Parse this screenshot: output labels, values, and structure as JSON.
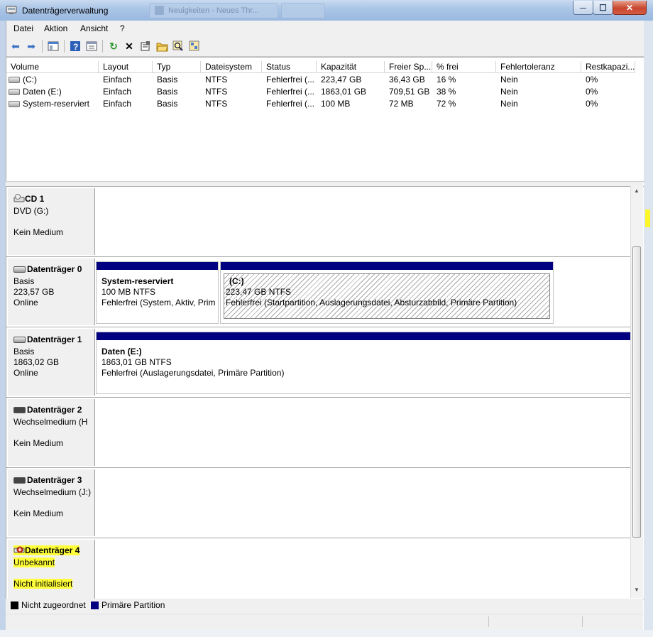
{
  "window": {
    "title": "Datenträgerverwaltung",
    "ghost_tabs": [
      "Neuigkeiten - Neues Thr..."
    ],
    "buttons": {
      "minimize": "─",
      "maximize": "☐",
      "close": "✕"
    }
  },
  "menu": [
    "Datei",
    "Aktion",
    "Ansicht",
    "?"
  ],
  "toolbar_icons": [
    "back-arrow-icon",
    "forward-arrow-icon",
    "console-tree-icon",
    "help-icon",
    "show-hide-icon",
    "refresh-icon",
    "delete-icon",
    "properties-icon",
    "open-folder-icon",
    "search-icon",
    "explore-icon"
  ],
  "volume_list": {
    "columns": [
      "Volume",
      "Layout",
      "Typ",
      "Dateisystem",
      "Status",
      "Kapazität",
      "Freier Sp...",
      "% frei",
      "Fehlertoleranz",
      "Restkapazi..."
    ],
    "rows": [
      [
        "(C:)",
        "Einfach",
        "Basis",
        "NTFS",
        "Fehlerfrei (...",
        "223,47 GB",
        "36,43 GB",
        "16 %",
        "Nein",
        "0%"
      ],
      [
        "Daten (E:)",
        "Einfach",
        "Basis",
        "NTFS",
        "Fehlerfrei (...",
        "1863,01 GB",
        "709,51 GB",
        "38 %",
        "Nein",
        "0%"
      ],
      [
        "System-reserviert",
        "Einfach",
        "Basis",
        "NTFS",
        "Fehlerfrei (...",
        "100 MB",
        "72 MB",
        "72 %",
        "Nein",
        "0%"
      ]
    ]
  },
  "disks": [
    {
      "name": "CD 1",
      "line1": "DVD (G:)",
      "line2": "",
      "line3": "Kein Medium",
      "partitions": []
    },
    {
      "name": "Datenträger 0",
      "line1": "Basis",
      "line2": "223,57 GB",
      "line3": "Online",
      "partitions": [
        {
          "title": "System-reserviert",
          "size": "100 MB NTFS",
          "status": "Fehlerfrei (System, Aktiv, Prim"
        },
        {
          "title": "(C:)",
          "size": "223,47 GB NTFS",
          "status": "Fehlerfrei (Startpartition, Auslagerungsdatei, Absturzabbild, Primäre Partition)"
        }
      ]
    },
    {
      "name": "Datenträger 1",
      "line1": "Basis",
      "line2": "1863,02 GB",
      "line3": "Online",
      "partitions": [
        {
          "title": "Daten  (E:)",
          "size": "1863,01 GB NTFS",
          "status": "Fehlerfrei (Auslagerungsdatei, Primäre Partition)"
        }
      ]
    },
    {
      "name": "Datenträger 2",
      "line1": "Wechselmedium (H",
      "line2": "",
      "line3": "Kein Medium",
      "partitions": []
    },
    {
      "name": "Datenträger 3",
      "line1": "Wechselmedium (J:)",
      "line2": "",
      "line3": "Kein Medium",
      "partitions": []
    },
    {
      "name": "Datenträger 4",
      "line1": "Unbekannt",
      "line2": "",
      "line3": "Nicht initialisiert",
      "partitions": []
    }
  ],
  "legend": [
    {
      "label": "Nicht zugeordnet",
      "color": "#000000"
    },
    {
      "label": "Primäre Partition",
      "color": "#000080"
    }
  ],
  "colors": {
    "primary_partition": "#000080",
    "highlight": "#ffff3a"
  }
}
